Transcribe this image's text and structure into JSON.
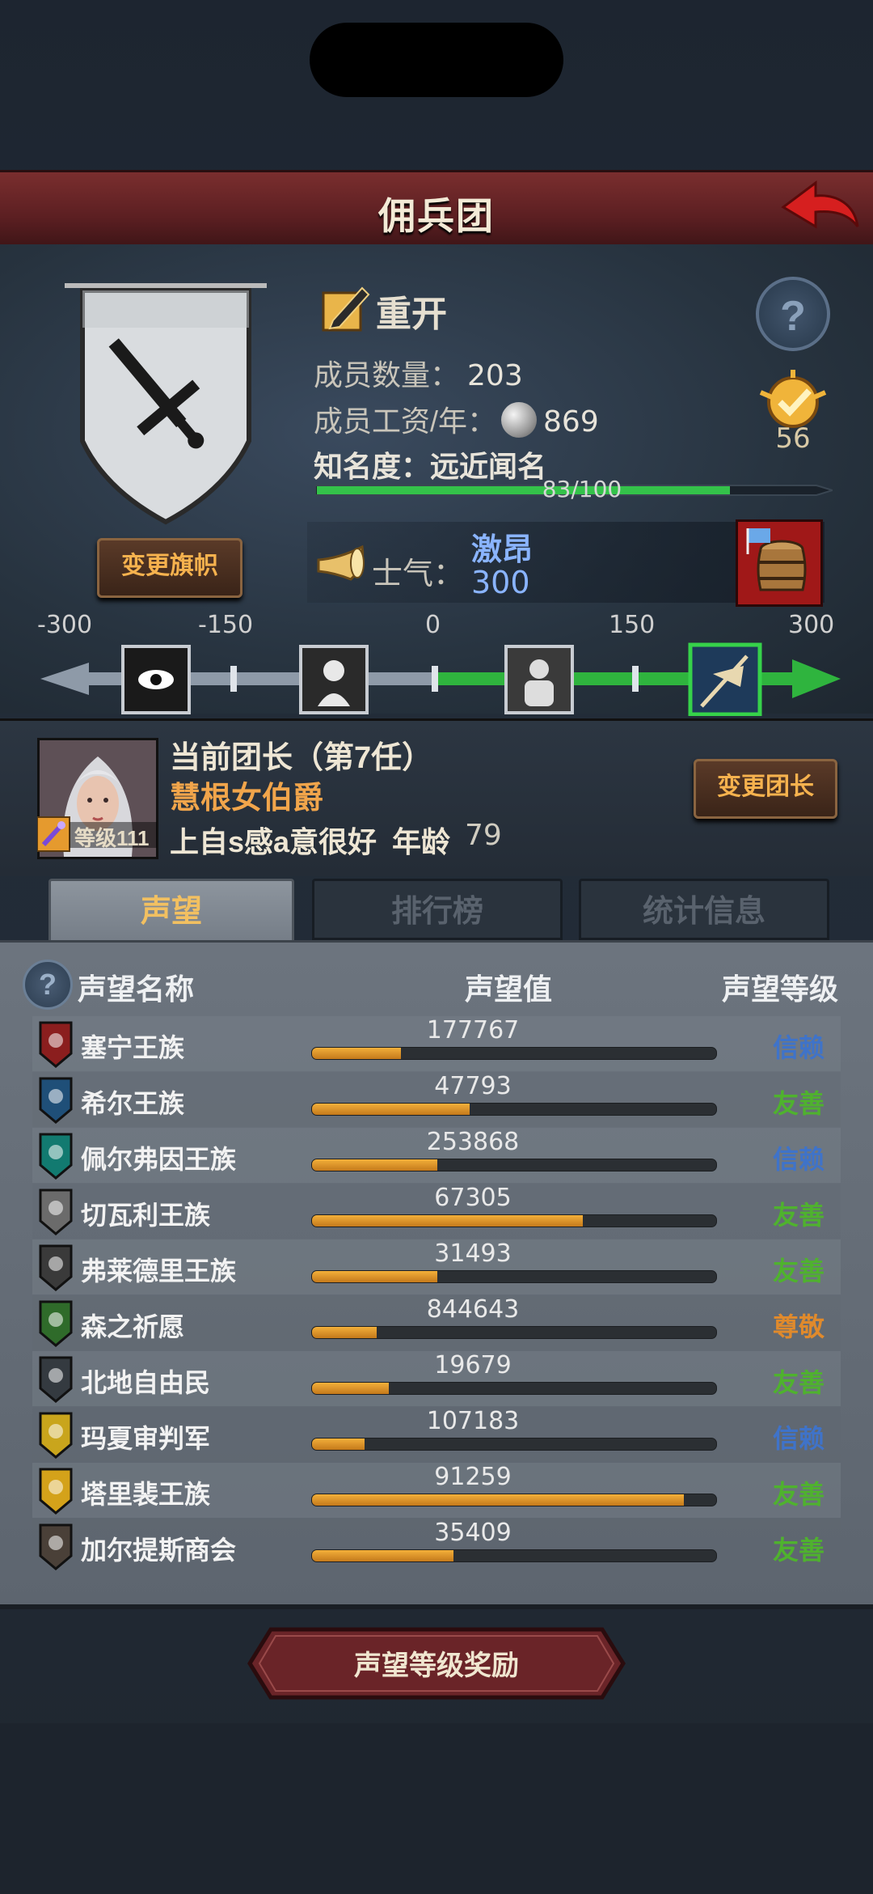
{
  "header": {
    "title": "佣兵团"
  },
  "clan": {
    "name": "重开",
    "flag_button": "变更旗帜",
    "members_label": "成员数量：",
    "members": "203",
    "wage_label": "成员工资/年：",
    "wage": "869",
    "fame_label": "知名度：",
    "fame_title": "远近闻名",
    "fame_progress_text": "83/100",
    "fame_progress": 0.83,
    "rank": "56",
    "morale_label": "士气：",
    "morale_state": "激昂",
    "morale_value": "300"
  },
  "morale_scale": {
    "ticks": [
      "-300",
      "-150",
      "0",
      "150",
      "300"
    ],
    "current_value": 300
  },
  "leader": {
    "title": "当前团长（第7任）",
    "name": "慧根女伯爵",
    "level": "等级111",
    "traits": "上自s感a意很好",
    "age_label": "年龄",
    "age": "79",
    "change_button": "变更团长"
  },
  "tabs": [
    "声望",
    "排行榜",
    "统计信息"
  ],
  "reputation": {
    "columns": {
      "name": "声望名称",
      "value": "声望值",
      "level": "声望等级"
    },
    "rows": [
      {
        "name": "塞宁王族",
        "value": "177767",
        "level": "信赖",
        "progress": 0.22,
        "crest_color": "#8b1e1e",
        "level_color": "#3f73c9"
      },
      {
        "name": "希尔王族",
        "value": "47793",
        "level": "友善",
        "progress": 0.39,
        "crest_color": "#1f4f78",
        "level_color": "#4fb22e"
      },
      {
        "name": "佩尔弗因王族",
        "value": "253868",
        "level": "信赖",
        "progress": 0.31,
        "crest_color": "#127a70",
        "level_color": "#3f73c9"
      },
      {
        "name": "切瓦利王族",
        "value": "67305",
        "level": "友善",
        "progress": 0.67,
        "crest_color": "#6b6b6b",
        "level_color": "#4fb22e"
      },
      {
        "name": "弗莱德里王族",
        "value": "31493",
        "level": "友善",
        "progress": 0.31,
        "crest_color": "#3a3a3a",
        "level_color": "#4fb22e"
      },
      {
        "name": "森之祈愿",
        "value": "844643",
        "level": "尊敬",
        "progress": 0.16,
        "crest_color": "#2f6b2a",
        "level_color": "#e08a2c"
      },
      {
        "name": "北地自由民",
        "value": "19679",
        "level": "友善",
        "progress": 0.19,
        "crest_color": "#343a40",
        "level_color": "#4fb22e"
      },
      {
        "name": "玛夏审判军",
        "value": "107183",
        "level": "信赖",
        "progress": 0.13,
        "crest_color": "#c9a51c",
        "level_color": "#3f73c9"
      },
      {
        "name": "塔里裴王族",
        "value": "91259",
        "level": "友善",
        "progress": 0.92,
        "crest_color": "#d4a21a",
        "level_color": "#4fb22e"
      },
      {
        "name": "加尔提斯商会",
        "value": "35409",
        "level": "友善",
        "progress": 0.35,
        "crest_color": "#4a4038",
        "level_color": "#4fb22e"
      }
    ]
  },
  "reward_button": "声望等级奖励"
}
